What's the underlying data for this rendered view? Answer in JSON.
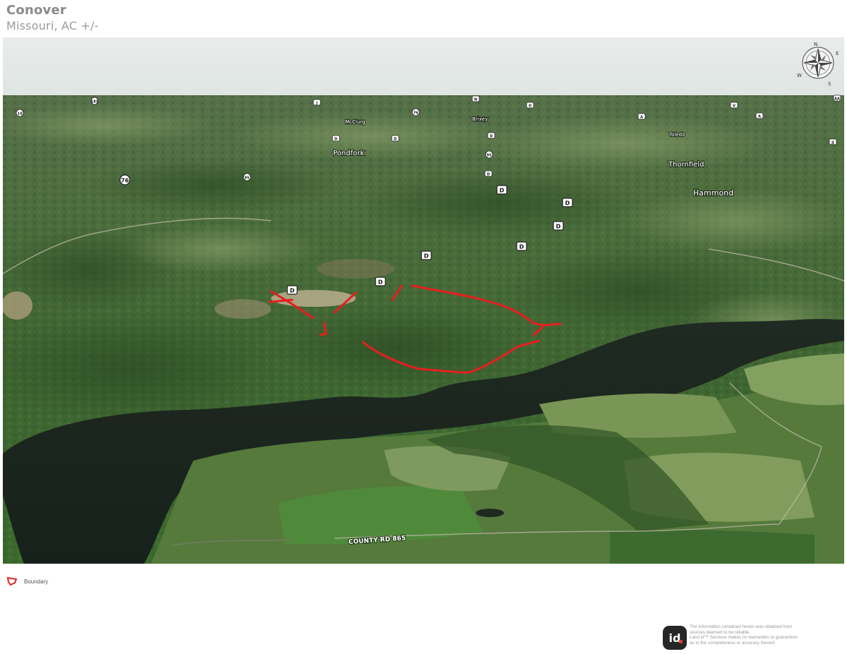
{
  "header": {
    "title": "Conover",
    "subtitle": "Missouri,  AC +/-"
  },
  "map": {
    "compass_letters": [
      "N",
      "E",
      "S",
      "W"
    ],
    "places": [
      {
        "name": "Pondfork"
      },
      {
        "name": "Thornfield"
      },
      {
        "name": "Hammond"
      },
      {
        "name": "Toledo"
      },
      {
        "name": "McClurg"
      },
      {
        "name": "Brixey"
      }
    ],
    "road_label": "COUNTY RD 865",
    "route_markers": [
      "D",
      "D",
      "D",
      "D",
      "D",
      "D",
      "D",
      "D",
      "D",
      "D",
      "D",
      "95",
      "95",
      "76",
      "76",
      "181",
      "14",
      "J",
      "V",
      "O",
      "A",
      "A",
      "N",
      "JJ",
      "AA"
    ]
  },
  "legend": {
    "items": [
      {
        "label": "Boundary",
        "color": "#e02020"
      }
    ]
  },
  "footer": {
    "logo_text": "id",
    "disclaimer_lines": [
      "The information contained herein was obtained from",
      "sources deemed to be reliable.",
      "Land id™ Services makes no warranties or guarantees",
      "as to the completeness or accuracy thereof."
    ]
  }
}
